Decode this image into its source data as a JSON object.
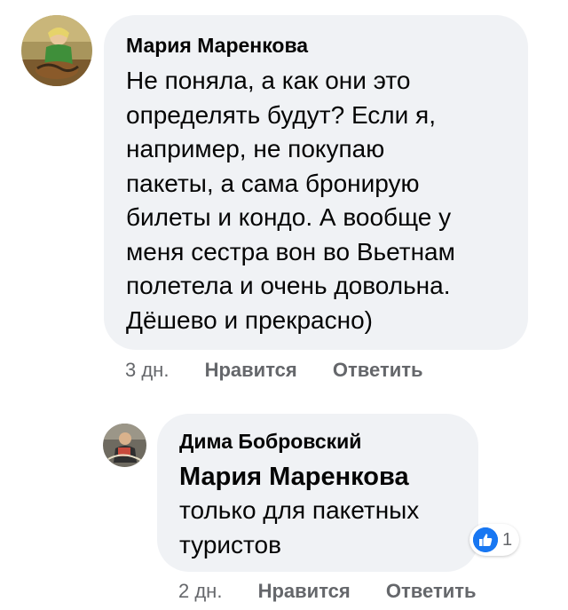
{
  "comment": {
    "author": "Мария Маренкова",
    "lines": [
      "Не поняла, а как они это",
      "определять будут? Если я,",
      "например, не покупаю",
      "пакеты, а сама бронирую",
      "билеты и кондо. А вообще у",
      "меня сестра вон во Вьетнам",
      "полетела и очень довольна.",
      "Дёшево и прекрасно)"
    ],
    "time": "3 дн.",
    "like_label": "Нравится",
    "reply_label": "Ответить"
  },
  "reply": {
    "author": "Дима Бобровский",
    "mention": "Мария Маренкова",
    "lines": [
      "только для пакетных",
      "туристов"
    ],
    "reaction_icon": "like-icon",
    "reaction_count": "1",
    "time": "2 дн.",
    "like_label": "Нравится",
    "reply_label": "Ответить"
  },
  "colors": {
    "bubble": "#f0f2f5",
    "text": "#050505",
    "meta": "#65676b",
    "like_blue": "#1877f2"
  }
}
